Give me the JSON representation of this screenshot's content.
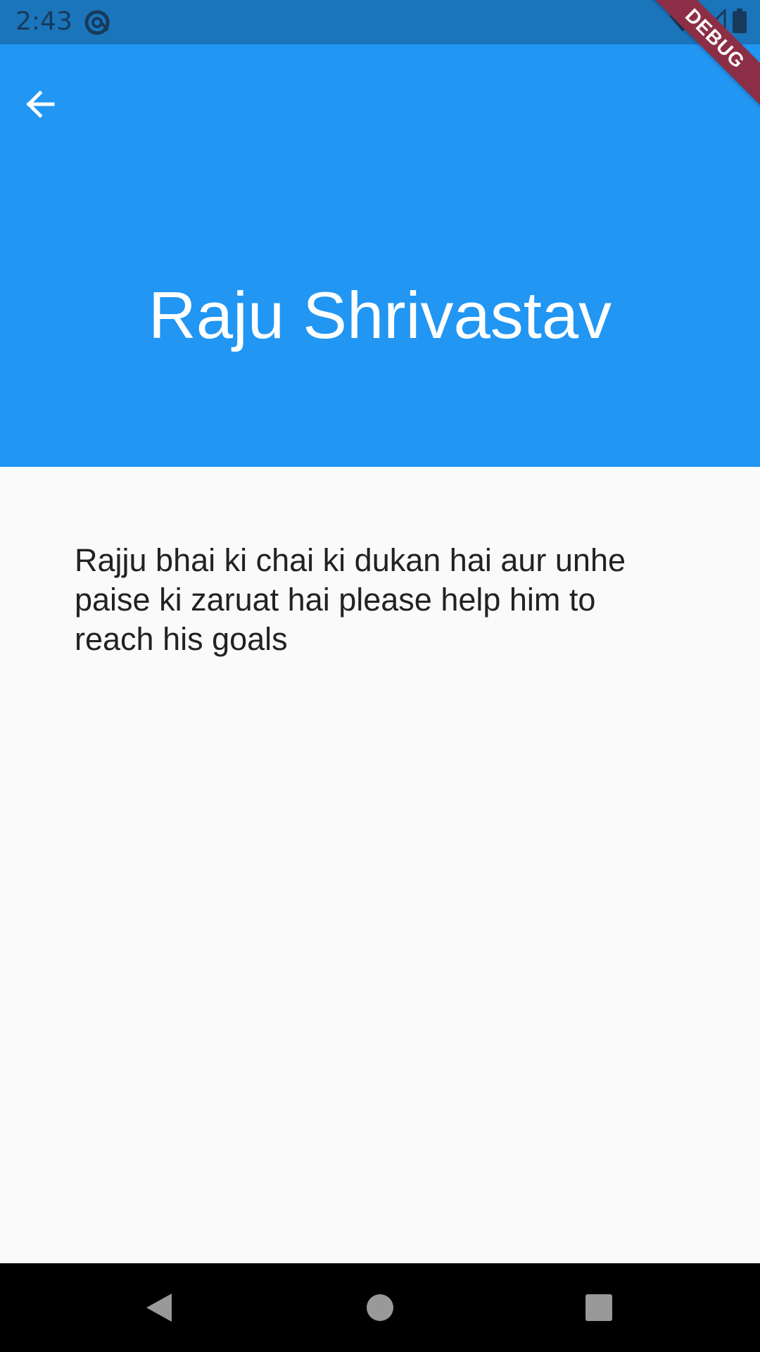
{
  "status_bar": {
    "time": "2:43",
    "app_icon": "at-sign-icon",
    "icons": [
      "wifi-icon",
      "signal-icon",
      "battery-icon"
    ]
  },
  "debug_banner": {
    "label": "DEBUG"
  },
  "app_bar": {
    "title": "Raju Shrivastav",
    "back_icon": "arrow-back-icon",
    "background": "#2196f3"
  },
  "body": {
    "description": "Rajju bhai ki chai ki dukan hai aur unhe paise ki zaruat hai please help him to reach his goals"
  },
  "nav_bar": {
    "buttons": [
      "back-triangle-icon",
      "home-circle-icon",
      "recents-square-icon"
    ]
  }
}
